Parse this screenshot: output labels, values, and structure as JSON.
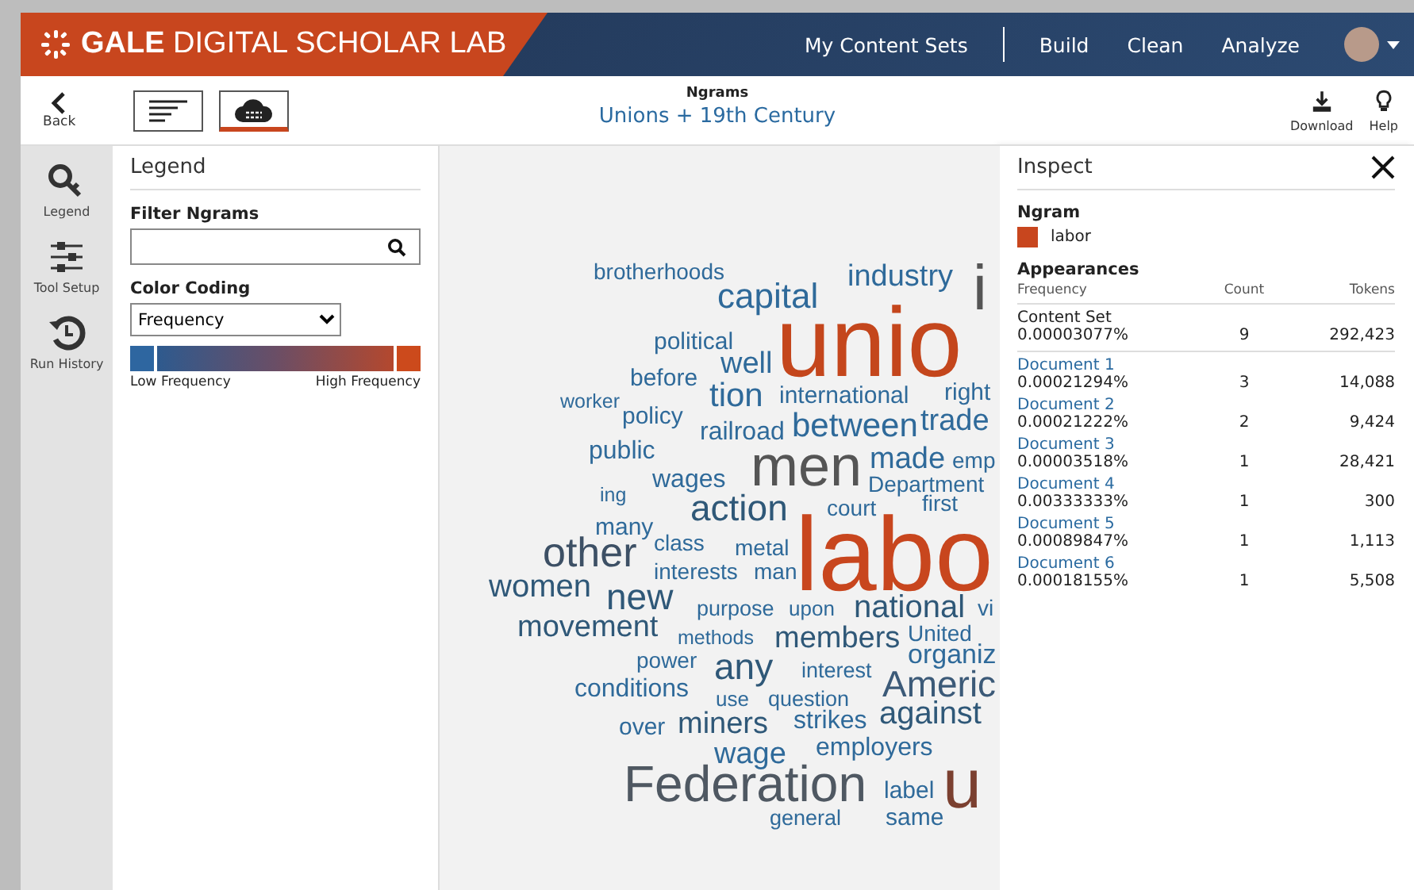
{
  "header": {
    "logo": "GALE DIGITAL SCHOLAR LAB",
    "nav": [
      {
        "label": "My Content Sets"
      },
      {
        "label": "Build"
      },
      {
        "label": "Clean"
      },
      {
        "label": "Analyze"
      }
    ]
  },
  "toolbar": {
    "back": "Back",
    "views": [
      {
        "kind": "list",
        "selected": false
      },
      {
        "kind": "cloud",
        "selected": true
      }
    ],
    "tool": "Ngrams",
    "title": "Unions + 19th Century",
    "actions": [
      {
        "kind": "download",
        "label": "Download"
      },
      {
        "kind": "help",
        "label": "Help"
      }
    ]
  },
  "rail": {
    "items": [
      {
        "kind": "legend",
        "label": "Legend"
      },
      {
        "kind": "setup",
        "label": "Tool Setup"
      },
      {
        "kind": "history",
        "label": "Run History"
      }
    ]
  },
  "legend": {
    "title": "Legend",
    "filter_label": "Filter Ngrams",
    "color_label": "Color Coding",
    "color_select": "Frequency",
    "low_label": "Low Frequency",
    "high_label": "High Frequency"
  },
  "word_cloud": {
    "words": [
      {
        "text": "brotherhoods",
        "color": "#2f6a9a"
      },
      {
        "text": "industry",
        "color": "#2f6a9a"
      },
      {
        "text": "capital",
        "color": "#2f6a9a"
      },
      {
        "text": "political",
        "color": "#2f6a9a"
      },
      {
        "text": "well",
        "color": "#2f6a9a"
      },
      {
        "text": "i",
        "color": "#555555"
      },
      {
        "text": "unio",
        "color": "#c4461c"
      },
      {
        "text": "before",
        "color": "#2f6a9a"
      },
      {
        "text": "worker",
        "color": "#2f6a9a"
      },
      {
        "text": "tion",
        "color": "#2f6a9a"
      },
      {
        "text": "international",
        "color": "#2f6a9a"
      },
      {
        "text": "right",
        "color": "#2f6a9a"
      },
      {
        "text": "policy",
        "color": "#2f6a9a"
      },
      {
        "text": "railroad",
        "color": "#2f6a9a"
      },
      {
        "text": "between",
        "color": "#2f6a9a"
      },
      {
        "text": "trade",
        "color": "#2f6a9a"
      },
      {
        "text": "public",
        "color": "#2f6a9a"
      },
      {
        "text": "men",
        "color": "#555555"
      },
      {
        "text": "made",
        "color": "#2f6a9a"
      },
      {
        "text": "emp",
        "color": "#2f6a9a"
      },
      {
        "text": "wages",
        "color": "#2f6a9a"
      },
      {
        "text": "Department",
        "color": "#2f6a9a"
      },
      {
        "text": "ing",
        "color": "#2f6a9a"
      },
      {
        "text": "action",
        "color": "#2f5878"
      },
      {
        "text": "court",
        "color": "#2f6a9a"
      },
      {
        "text": "first",
        "color": "#2f6a9a"
      },
      {
        "text": "many",
        "color": "#2f6a9a"
      },
      {
        "text": "other",
        "color": "#3d5065"
      },
      {
        "text": "class",
        "color": "#2f6a9a"
      },
      {
        "text": "metal",
        "color": "#2f6a9a"
      },
      {
        "text": "interests",
        "color": "#2f6a9a"
      },
      {
        "text": "man",
        "color": "#2f6a9a"
      },
      {
        "text": "women",
        "color": "#2f5878"
      },
      {
        "text": "new",
        "color": "#2f5878"
      },
      {
        "text": "labo",
        "color": "#c8461e"
      },
      {
        "text": "purpose",
        "color": "#2f6a9a"
      },
      {
        "text": "upon",
        "color": "#2f6a9a"
      },
      {
        "text": "national",
        "color": "#2f5878"
      },
      {
        "text": "vi",
        "color": "#2f6a9a"
      },
      {
        "text": "movement",
        "color": "#2f5878"
      },
      {
        "text": "methods",
        "color": "#2f6a9a"
      },
      {
        "text": "members",
        "color": "#2f5878"
      },
      {
        "text": "United",
        "color": "#2f6a9a"
      },
      {
        "text": "power",
        "color": "#2f6a9a"
      },
      {
        "text": "any",
        "color": "#2f5878"
      },
      {
        "text": "interest",
        "color": "#2f6a9a"
      },
      {
        "text": "organiz",
        "color": "#2f6a9a"
      },
      {
        "text": "conditions",
        "color": "#2f6a9a"
      },
      {
        "text": "use",
        "color": "#2f6a9a"
      },
      {
        "text": "question",
        "color": "#2f6a9a"
      },
      {
        "text": "Americ",
        "color": "#3c5a78"
      },
      {
        "text": "over",
        "color": "#2f6a9a"
      },
      {
        "text": "miners",
        "color": "#2f5878"
      },
      {
        "text": "strikes",
        "color": "#2f6a9a"
      },
      {
        "text": "against",
        "color": "#2f5878"
      },
      {
        "text": "wage",
        "color": "#2f6a9a"
      },
      {
        "text": "employers",
        "color": "#2f6a9a"
      },
      {
        "text": "Federation",
        "color": "#4f5862"
      },
      {
        "text": "label",
        "color": "#2f6a9a"
      },
      {
        "text": "u",
        "color": "#7b4030"
      },
      {
        "text": "general",
        "color": "#2f6a9a"
      },
      {
        "text": "same",
        "color": "#2f6a9a"
      }
    ]
  },
  "inspect": {
    "title": "Inspect",
    "ngram_label": "Ngram",
    "ngram": {
      "text": "labor",
      "color": "#c8461e"
    },
    "appearances_label": "Appearances",
    "columns": [
      "Frequency",
      "Count",
      "Tokens"
    ],
    "rows": [
      {
        "kind": "total",
        "name": "Content Set",
        "frequency": "0.00003077%",
        "count": "9",
        "tokens": "292,423"
      },
      {
        "kind": "document",
        "name": "Document 1",
        "frequency": "0.00021294%",
        "count": "3",
        "tokens": "14,088"
      },
      {
        "kind": "document",
        "name": "Document 2",
        "frequency": "0.00021222%",
        "count": "2",
        "tokens": "9,424"
      },
      {
        "kind": "document",
        "name": "Document 3",
        "frequency": "0.00003518%",
        "count": "1",
        "tokens": "28,421"
      },
      {
        "kind": "document",
        "name": "Document 4",
        "frequency": "0.00333333%",
        "count": "1",
        "tokens": "300"
      },
      {
        "kind": "document",
        "name": "Document 5",
        "frequency": "0.00089847%",
        "count": "1",
        "tokens": "1,113"
      },
      {
        "kind": "document",
        "name": "Document 6",
        "frequency": "0.00018155%",
        "count": "1",
        "tokens": "5,508"
      }
    ]
  }
}
